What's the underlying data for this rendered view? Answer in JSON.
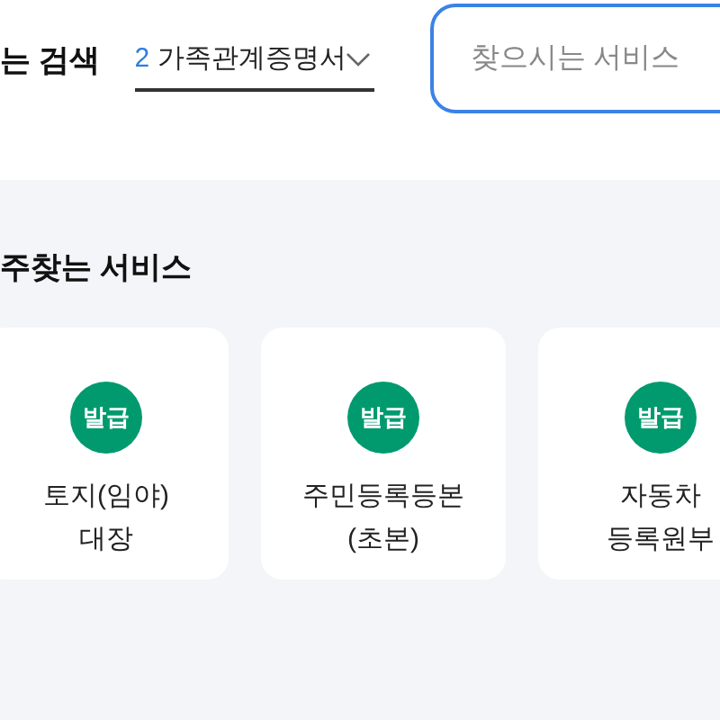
{
  "search": {
    "title": "는 검색",
    "dropdown": {
      "number": "2",
      "value": "가족관계증명서"
    },
    "field": {
      "placeholder": "찾으시는 서비스"
    }
  },
  "favorites": {
    "title": "주찾는 서비스",
    "items": [
      {
        "badge": "발급",
        "name": "토지(임야)\n대장"
      },
      {
        "badge": "발급",
        "name": "주민등록등본\n(초본)"
      },
      {
        "badge": "발급",
        "name": "자동차\n등록원부"
      }
    ]
  }
}
